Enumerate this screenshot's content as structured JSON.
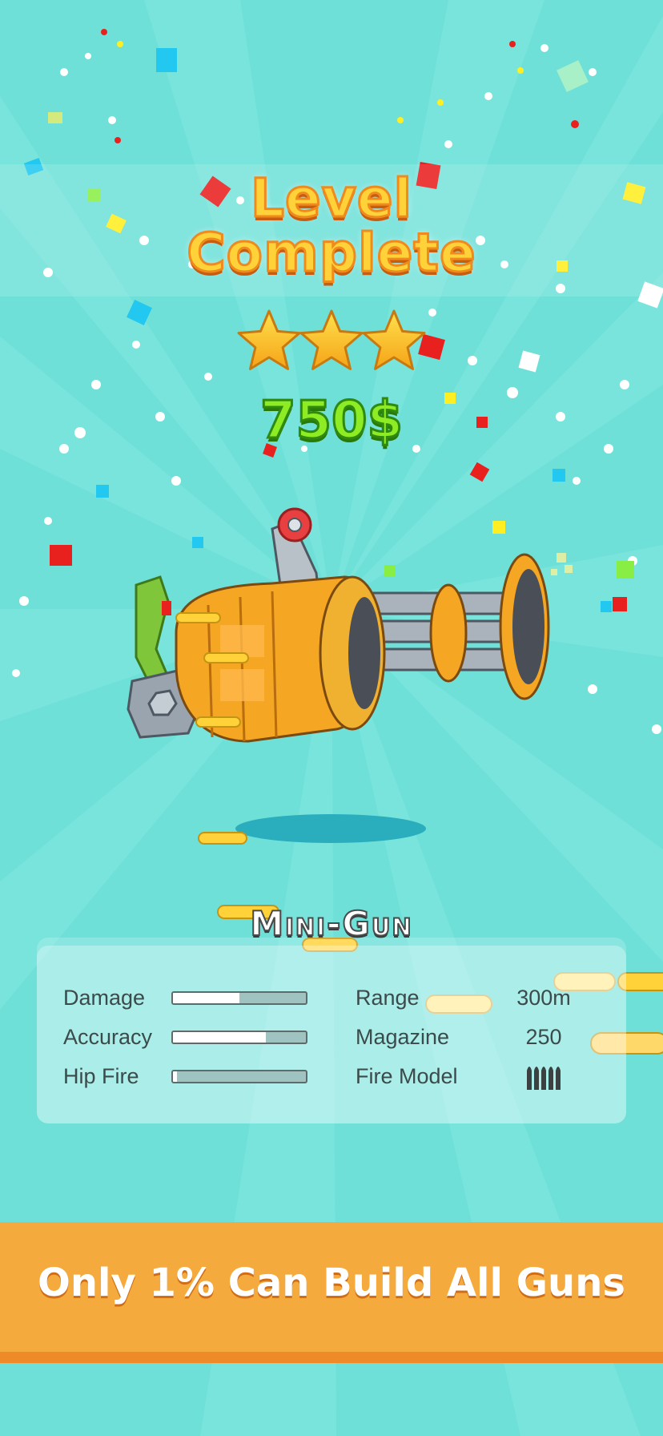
{
  "level_complete": {
    "title_line1": "Level",
    "title_line2": "Complete",
    "stars": 3,
    "stars_max": 3,
    "reward": "750$"
  },
  "weapon": {
    "name": "Mini-Gun",
    "stats": {
      "damage": {
        "label": "Damage",
        "level": 0.5
      },
      "accuracy": {
        "label": "Accuracy",
        "level": 0.7
      },
      "hip_fire": {
        "label": "Hip Fire",
        "level": 0.03
      },
      "range": {
        "label": "Range",
        "value": "300m"
      },
      "magazine": {
        "label": "Magazine",
        "value": "250"
      },
      "fire_model": {
        "label": "Fire Model",
        "icon": "bullets-icon"
      }
    }
  },
  "banner": {
    "text": "Only 1% Can Build All Guns"
  },
  "colors": {
    "background": "#6fe0d8",
    "title_fill": "#ffd23a",
    "reward_fill": "#8dec23",
    "banner": "#f4aa3c",
    "gun_body": "#f5a623"
  }
}
